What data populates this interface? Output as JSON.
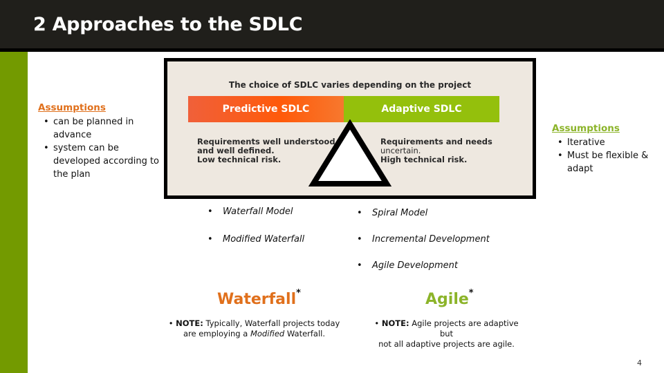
{
  "slide": {
    "title": "2 Approaches to the SDLC",
    "page_number": "4"
  },
  "colors": {
    "title_bar": "#201f1b",
    "rail_green": "#739a00",
    "predictive_orange": "#ff5a0a",
    "adaptive_green": "#94c00c",
    "waterfall_orange": "#e0701c",
    "agile_green": "#8cb42a",
    "frame_bg": "#eee8e0"
  },
  "left_assumptions": {
    "title": "Assumptions",
    "items": [
      "can be planned in advance",
      "system can be developed according to the plan"
    ]
  },
  "right_assumptions": {
    "title": "Assumptions",
    "items": [
      "Iterative",
      "Must be flexible & adapt"
    ]
  },
  "diagram": {
    "heading": "The choice of SDLC varies depending on the project",
    "predictive_label": "Predictive SDLC",
    "adaptive_label": "Adaptive SDLC",
    "predictive_desc": [
      "Requirements well understood",
      "and well defined.",
      "Low technical risk."
    ],
    "adaptive_desc": [
      "Requirements and needs",
      "uncertain.",
      "High technical risk."
    ],
    "fulcrum_icon": "triangle-icon"
  },
  "predictive_models": [
    "Waterfall Model",
    "Modified Waterfall"
  ],
  "adaptive_models": [
    "Spiral Model",
    "Incremental Development",
    "Agile Development"
  ],
  "waterfall": {
    "label": "Waterfall",
    "asterisk": "*",
    "note_prefix": "NOTE:",
    "note_line1": " Typically, Waterfall projects today",
    "note_line2_a": "are employing a ",
    "note_line2_em": "Modified",
    "note_line2_b": " Waterfall."
  },
  "agile": {
    "label": "Agile",
    "asterisk": "*",
    "note_prefix": "NOTE:",
    "note_line1": " Agile projects are adaptive but",
    "note_line2": "not all adaptive projects are agile."
  }
}
